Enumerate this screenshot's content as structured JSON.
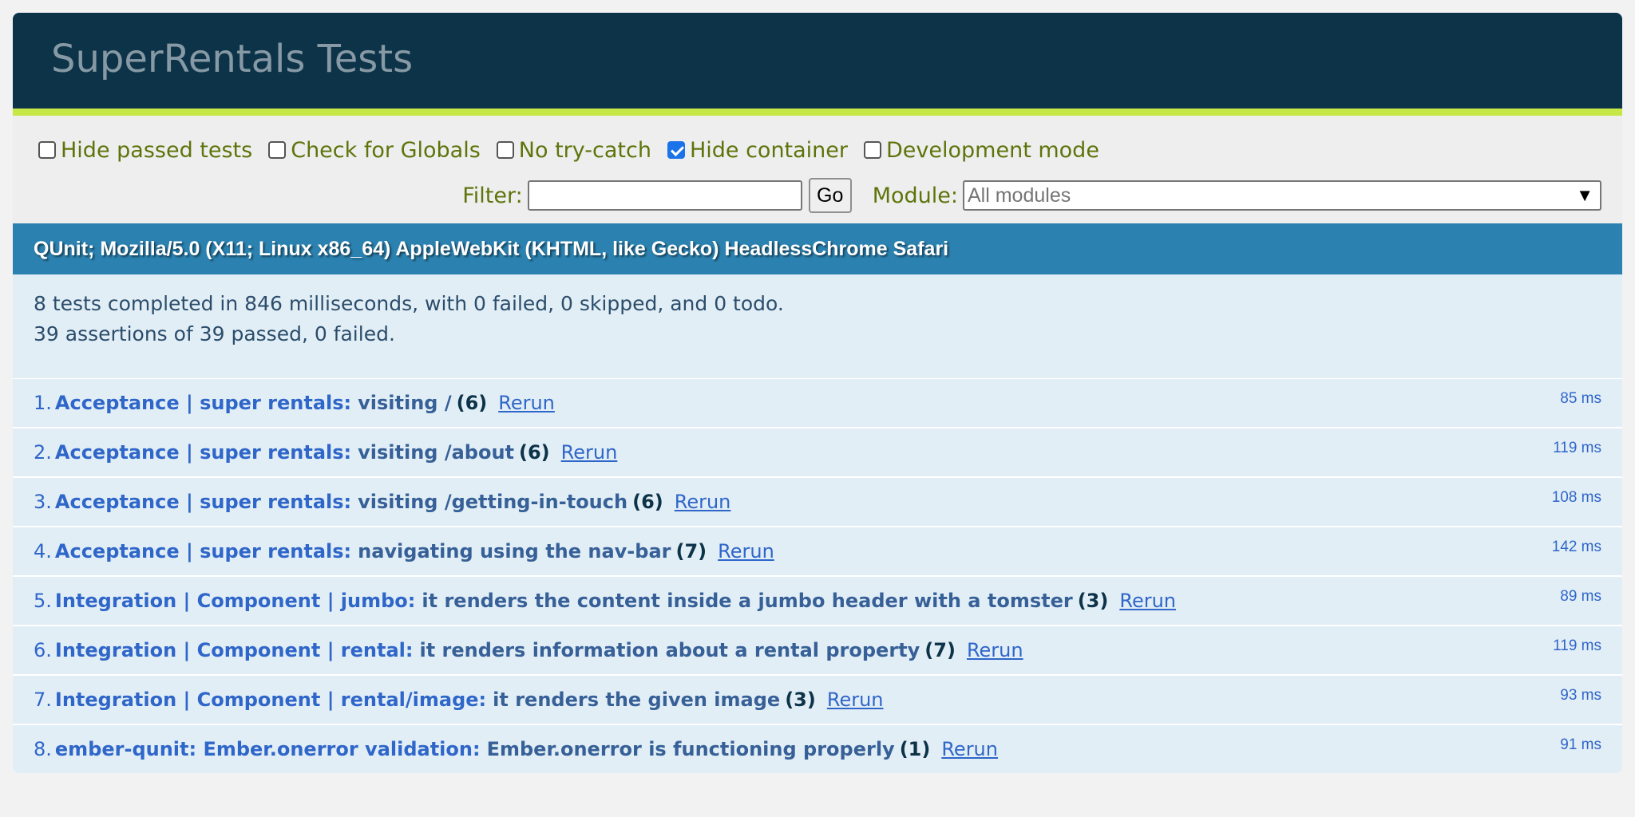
{
  "header": {
    "title": "SuperRentals Tests"
  },
  "toolbar": {
    "options": [
      {
        "label": "Hide passed tests",
        "checked": false
      },
      {
        "label": "Check for Globals",
        "checked": false
      },
      {
        "label": "No try-catch",
        "checked": false
      },
      {
        "label": "Hide container",
        "checked": true
      },
      {
        "label": "Development mode",
        "checked": false
      }
    ],
    "filter_label": "Filter:",
    "filter_value": "",
    "go_label": "Go",
    "module_label": "Module:",
    "module_selected": "All modules"
  },
  "useragent": "QUnit; Mozilla/5.0 (X11; Linux x86_64) AppleWebKit (KHTML, like Gecko) HeadlessChrome Safari",
  "result": {
    "line1": "8 tests completed in 846 milliseconds, with 0 failed, 0 skipped, and 0 todo.",
    "line2": "39 assertions of 39 passed, 0 failed."
  },
  "tests": [
    {
      "num": "1.",
      "module": "Acceptance | super rentals:",
      "name": "visiting /",
      "counts": "(6)",
      "rerun": "Rerun",
      "runtime": "85 ms"
    },
    {
      "num": "2.",
      "module": "Acceptance | super rentals:",
      "name": "visiting /about",
      "counts": "(6)",
      "rerun": "Rerun",
      "runtime": "119 ms"
    },
    {
      "num": "3.",
      "module": "Acceptance | super rentals:",
      "name": "visiting /getting-in-touch",
      "counts": "(6)",
      "rerun": "Rerun",
      "runtime": "108 ms"
    },
    {
      "num": "4.",
      "module": "Acceptance | super rentals:",
      "name": "navigating using the nav-bar",
      "counts": "(7)",
      "rerun": "Rerun",
      "runtime": "142 ms"
    },
    {
      "num": "5.",
      "module": "Integration | Component | jumbo:",
      "name": "it renders the content inside a jumbo header with a tomster",
      "counts": "(3)",
      "rerun": "Rerun",
      "runtime": "89 ms"
    },
    {
      "num": "6.",
      "module": "Integration | Component | rental:",
      "name": "it renders information about a rental property",
      "counts": "(7)",
      "rerun": "Rerun",
      "runtime": "119 ms"
    },
    {
      "num": "7.",
      "module": "Integration | Component | rental/image:",
      "name": "it renders the given image",
      "counts": "(3)",
      "rerun": "Rerun",
      "runtime": "93 ms"
    },
    {
      "num": "8.",
      "module": "ember-qunit: Ember.onerror validation:",
      "name": "Ember.onerror is functioning properly",
      "counts": "(1)",
      "rerun": "Rerun",
      "runtime": "91 ms"
    }
  ],
  "colors": {
    "header_bg": "#0d3349",
    "header_accent": "#c6e746",
    "ua_bg": "#2b81af",
    "pass_bg": "#e2eef6",
    "link": "#2f66c9"
  }
}
